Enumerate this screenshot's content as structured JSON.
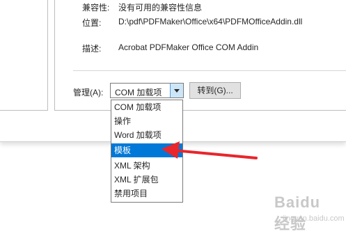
{
  "details": {
    "compat_label": "兼容性:",
    "compat_value": "没有可用的兼容性信息",
    "location_label": "位置:",
    "location_value": "D:\\pdf\\PDFMaker\\Office\\x64\\PDFMOfficeAddin.dll",
    "desc_label": "描述:",
    "desc_value": "Acrobat PDFMaker Office COM Addin"
  },
  "manage": {
    "label": "管理(A):",
    "selected_value": "COM 加载项",
    "go_button": "转到(G)..."
  },
  "dropdown": {
    "options": [
      "COM 加载项",
      "操作",
      "Word 加载项",
      "模板",
      "XML 架构",
      "XML 扩展包",
      "禁用项目"
    ],
    "highlighted_index": 3
  },
  "annotation": {
    "arrow_color": "#e8262c"
  },
  "watermark": {
    "text": "Baidu经验",
    "url": "jingyan.baidu.com"
  },
  "colors": {
    "highlight": "#0078d7",
    "dropdown_button": "#cde6f7"
  }
}
